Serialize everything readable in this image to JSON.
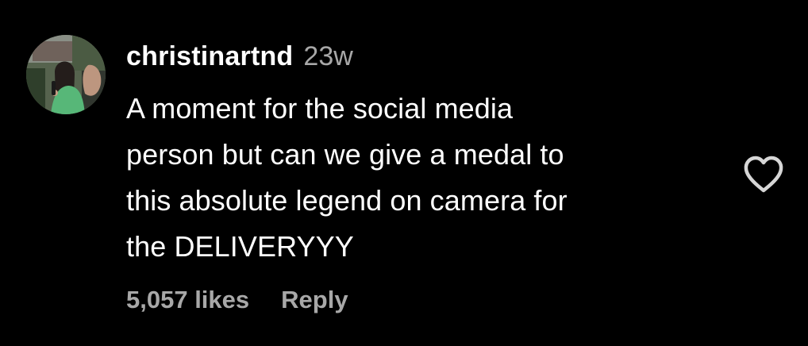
{
  "comment": {
    "username": "christinartnd",
    "timestamp": "23w",
    "text_lines": [
      "A moment for the social media",
      "person but can we give a medal to",
      "this absolute legend on camera for",
      "the DELIVERYYY"
    ],
    "likes": "5,057 likes",
    "reply_label": "Reply",
    "avatar_icon": "profile-photo",
    "like_icon": "heart-outline-icon"
  },
  "colors": {
    "background": "#000000",
    "primary_text": "#ffffff",
    "secondary_text": "#a8a8a8",
    "icon": "#d6d6d6"
  }
}
